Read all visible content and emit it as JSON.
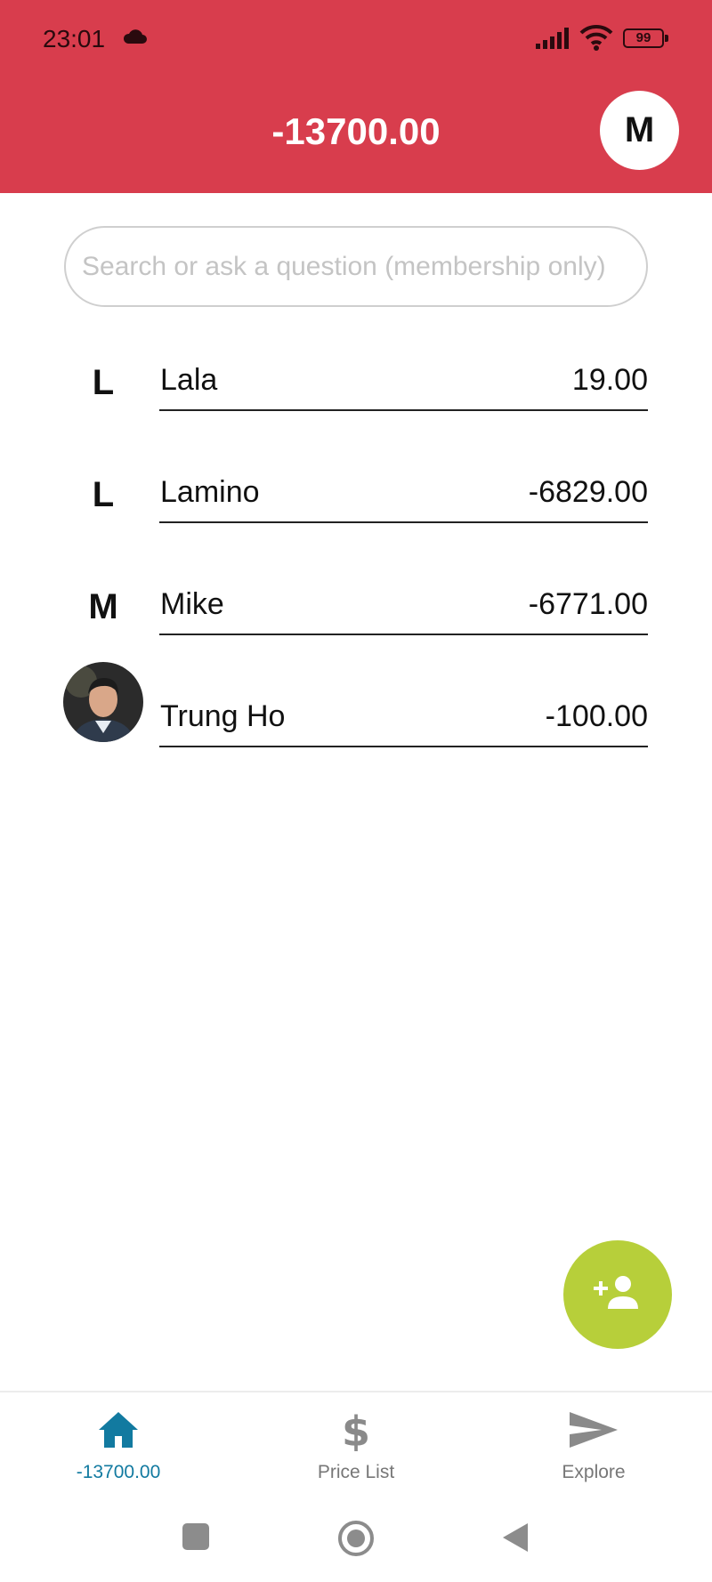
{
  "status_bar": {
    "time": "23:01",
    "battery": "99"
  },
  "header": {
    "balance": "-13700.00",
    "profile_initial": "M"
  },
  "search": {
    "placeholder": "Search or ask a question (membership only)"
  },
  "members": [
    {
      "initial": "L",
      "name": "Lala",
      "amount": "19.00",
      "avatar": "letter"
    },
    {
      "initial": "L",
      "name": "Lamino",
      "amount": "-6829.00",
      "avatar": "letter"
    },
    {
      "initial": "M",
      "name": "Mike",
      "amount": "-6771.00",
      "avatar": "letter"
    },
    {
      "initial": "",
      "name": "Trung Ho",
      "amount": "-100.00",
      "avatar": "photo"
    }
  ],
  "fab": {
    "icon": "add-person-icon"
  },
  "bottom_nav": {
    "items": [
      {
        "label": "-13700.00",
        "icon": "home-icon",
        "active": true
      },
      {
        "label": "Price List",
        "icon": "dollar-icon",
        "active": false
      },
      {
        "label": "Explore",
        "icon": "send-icon",
        "active": false
      }
    ]
  },
  "colors": {
    "header": "#d83d4d",
    "fab": "#b7cf3a",
    "nav_active": "#127aa0",
    "nav_inactive": "#777777"
  }
}
